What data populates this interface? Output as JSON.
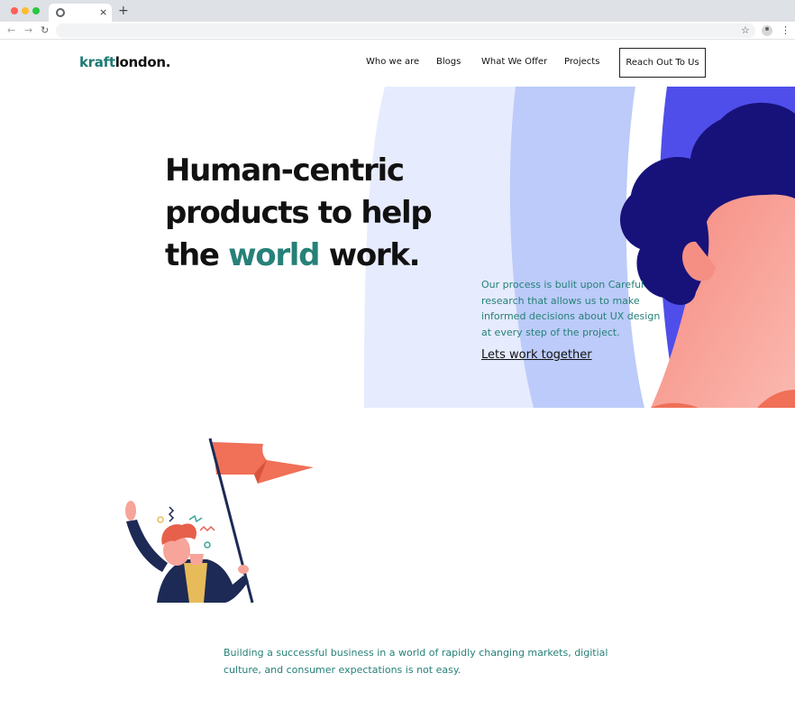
{
  "browser": {
    "tab_close": "×",
    "new_tab": "+",
    "back": "←",
    "forward": "→",
    "reload": "↻",
    "star": "☆",
    "menu": "⋮"
  },
  "header": {
    "logo_part1": "kraft",
    "logo_part2": "london.",
    "nav": [
      "Who we are",
      "Blogs",
      "What We Offer",
      "Projects"
    ],
    "cta": "Reach Out To Us"
  },
  "hero": {
    "title_line1": "Human-centric",
    "title_line2": "products to help",
    "title_line3_pre": "the ",
    "title_line3_accent": "world",
    "title_line3_post": " work.",
    "description": "Our process is bulit upon Careful research that allows us to make informed decisions about UX design at every step of the project.",
    "link": "Lets work together"
  },
  "intro": {
    "text": "Building a successful business in a world of rapidly changing markets, digitial culture, and consumer expectations is not easy."
  },
  "colors": {
    "brand_teal": "#268178",
    "hero_light_blue": "#e6ebfe",
    "hero_mid_blue": "#bccbf9",
    "hero_royal_blue": "#4f4eea",
    "hair_navy": "#17127a",
    "skin_peach": "#f7a49a",
    "flag_coral": "#f07058"
  },
  "icons": {
    "tab_favicon": "chrome-icon",
    "profile": "account-icon",
    "hero_illustration": "person-face-illustration",
    "celebration_illustration": "person-waving-flag-illustration"
  }
}
